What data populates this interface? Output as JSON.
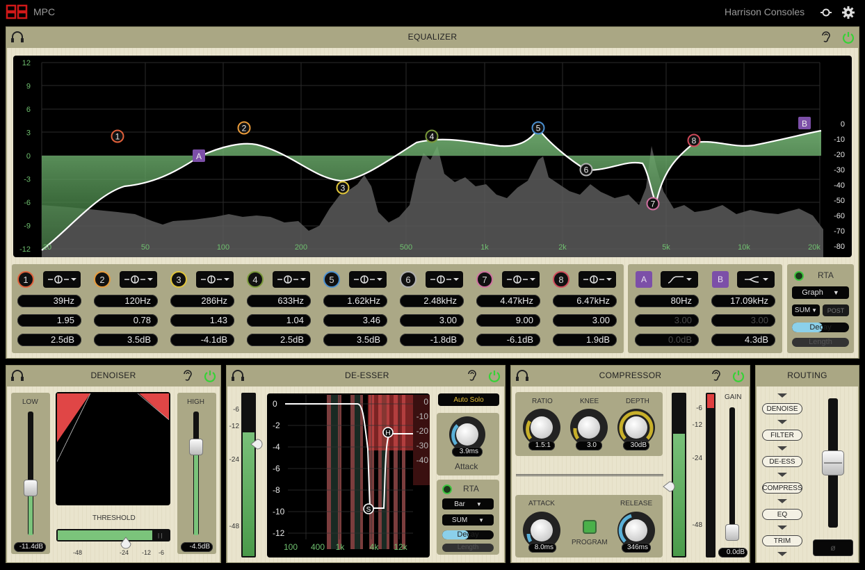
{
  "top": {
    "brand": "MPC",
    "company": "Harrison Consoles"
  },
  "eq": {
    "title": "EQUALIZER",
    "yaxis_left": [
      "12",
      "9",
      "6",
      "3",
      "0",
      "-3",
      "-6",
      "-9",
      "-12"
    ],
    "yaxis_right": [
      "0",
      "-10",
      "-20",
      "-30",
      "-40",
      "-50",
      "-60",
      "-70",
      "-80"
    ],
    "xaxis": [
      "20",
      "50",
      "100",
      "200",
      "500",
      "1k",
      "2k",
      "5k",
      "10k",
      "20k"
    ],
    "markers": [
      "1",
      "2",
      "3",
      "4",
      "5",
      "6",
      "7",
      "8"
    ],
    "marker_colors": [
      "#e0603a",
      "#e89a3a",
      "#e0c53a",
      "#7a9a3a",
      "#4a8fd0",
      "#b0b0b0",
      "#d070a0",
      "#d04a5a"
    ],
    "bands": [
      {
        "num": "1",
        "freq": "39Hz",
        "q": "1.95",
        "gain": "2.5dB"
      },
      {
        "num": "2",
        "freq": "120Hz",
        "q": "0.78",
        "gain": "3.5dB"
      },
      {
        "num": "3",
        "freq": "286Hz",
        "q": "1.43",
        "gain": "-4.1dB"
      },
      {
        "num": "4",
        "freq": "633Hz",
        "q": "1.04",
        "gain": "2.5dB"
      },
      {
        "num": "5",
        "freq": "1.62kHz",
        "q": "3.46",
        "gain": "3.5dB"
      },
      {
        "num": "6",
        "freq": "2.48kHz",
        "q": "3.00",
        "gain": "-1.8dB"
      },
      {
        "num": "7",
        "freq": "4.47kHz",
        "q": "9.00",
        "gain": "-6.1dB"
      },
      {
        "num": "8",
        "freq": "6.47kHz",
        "q": "3.00",
        "gain": "1.9dB"
      }
    ],
    "filters": [
      {
        "label": "A",
        "freq": "80Hz",
        "q": "3.00",
        "gain": "0.0dB"
      },
      {
        "label": "B",
        "freq": "17.09kHz",
        "q": "3.00",
        "gain": "4.3dB"
      }
    ],
    "rta": {
      "label": "RTA",
      "mode": "Graph",
      "sum": "SUM",
      "post": "POST",
      "decay": "Decay",
      "length": "Length"
    }
  },
  "denoiser": {
    "title": "DENOISER",
    "low": "LOW",
    "high": "HIGH",
    "threshold": "THRESHOLD",
    "low_val": "-11.4dB",
    "high_val": "-4.5dB",
    "scale": [
      "-48",
      "-24",
      "-12",
      "-6"
    ]
  },
  "deesser": {
    "title": "DE-ESSER",
    "meter_scale": [
      "-6",
      "-12",
      "-24",
      "-48"
    ],
    "y_axis": [
      "0",
      "-2",
      "-4",
      "-6",
      "-8",
      "-10",
      "-12"
    ],
    "y_right": [
      "0",
      "-10",
      "-20",
      "-30",
      "-40"
    ],
    "x_axis": [
      "100",
      "400",
      "1k",
      "4k",
      "12k"
    ],
    "auto_solo": "Auto Solo",
    "attack_val": "3.9ms",
    "attack": "Attack",
    "rta": "RTA",
    "mode": "Bar",
    "sum": "SUM",
    "decay": "Decay",
    "length": "Length",
    "h": "H",
    "s": "S"
  },
  "compressor": {
    "title": "COMPRESSOR",
    "ratio": "RATIO",
    "knee": "KNEE",
    "depth": "DEPTH",
    "ratio_val": "1.5:1",
    "knee_val": "3.0",
    "depth_val": "30dB",
    "attack": "ATTACK",
    "release": "RELEASE",
    "program": "PROGRAM",
    "attack_val": "8.0ms",
    "release_val": "346ms",
    "gain": "GAIN",
    "gain_val": "0.0dB",
    "scale": [
      "-6",
      "-12",
      "-24",
      "-48"
    ]
  },
  "routing": {
    "title": "ROUTING",
    "items": [
      "DENOISE",
      "FILTER",
      "DE-ESS",
      "COMPRESS",
      "EQ",
      "TRIM"
    ],
    "phase": "ø"
  }
}
